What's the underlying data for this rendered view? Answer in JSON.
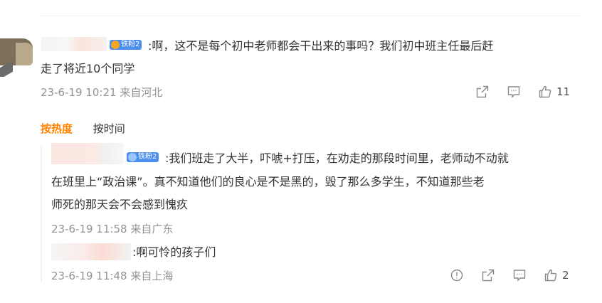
{
  "comment": {
    "badge": "铁粉2",
    "text_line1": ":啊，这不是每个初中老师都会干出来的事吗？我们初中班主任最后赶",
    "text_line2": "走了将近10个同学",
    "time": "23-6-19 10:21",
    "location": "来自河北",
    "like_count": "11"
  },
  "sort_tabs": {
    "hot": "按热度",
    "time": "按时间"
  },
  "replies": [
    {
      "badge": "铁粉2",
      "text_line1": ":我们班走了大半，吓唬+打压，在劝走的那段时间里，老师动不动就",
      "text_line2": "在班里上“政治课”。真不知道他们的良心是不是黑的，毁了那么多学生，不知道那些老",
      "text_line3": "师死的那天会不会感到愧疚",
      "time": "23-6-19 11:58",
      "location": "来自广东"
    },
    {
      "text": ":啊可怜的孩子们",
      "time": "23-6-19 11:48",
      "location": "来自上海",
      "like_count": "2"
    }
  ],
  "icons": {
    "share": "share-icon",
    "comment": "comment-icon",
    "like": "thumbs-up-icon",
    "report": "report-icon"
  },
  "colors": {
    "accent": "#ff8200",
    "meta": "#939393",
    "text": "#333333",
    "badge_gold": "#f5a623",
    "badge_blue": "#4a8ef0"
  }
}
